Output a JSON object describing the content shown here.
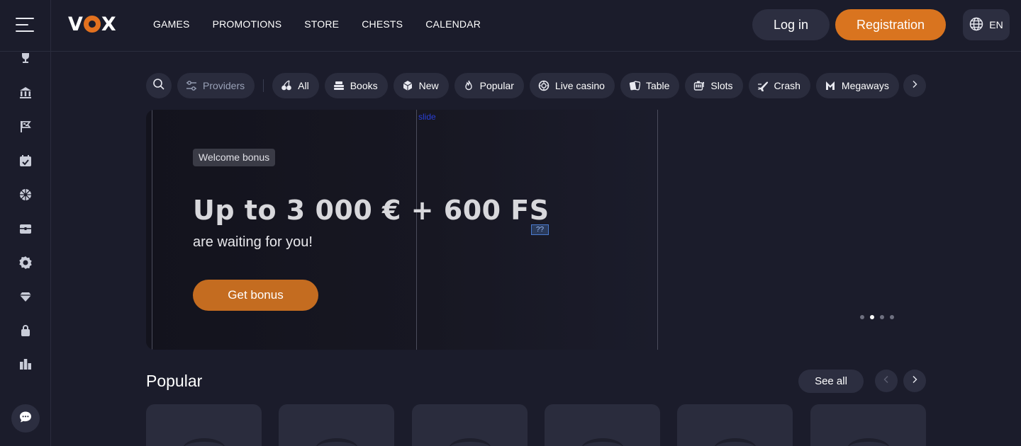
{
  "brand": {
    "logo_text": "VOX",
    "accent_color": "#d9741f"
  },
  "nav": {
    "items": [
      "GAMES",
      "PROMOTIONS",
      "STORE",
      "CHESTS",
      "CALENDAR"
    ]
  },
  "auth": {
    "login_label": "Log in",
    "register_label": "Registration"
  },
  "language": {
    "code": "EN",
    "icon": "globe-icon"
  },
  "sidebar": {
    "icons": [
      "trophy-icon",
      "bank-icon",
      "flags-icon",
      "calendar-icon",
      "wheel-icon",
      "chest-icon",
      "badge-icon",
      "diamond-icon",
      "lock-icon",
      "leaderboard-icon"
    ],
    "chat_icon": "chat-icon"
  },
  "filters": {
    "providers_label": "Providers",
    "categories": [
      {
        "label": "All",
        "icon": "cherries-icon"
      },
      {
        "label": "Books",
        "icon": "books-icon"
      },
      {
        "label": "New",
        "icon": "dice-icon"
      },
      {
        "label": "Popular",
        "icon": "fire-icon"
      },
      {
        "label": "Live casino",
        "icon": "chip-icon"
      },
      {
        "label": "Table",
        "icon": "cards-icon"
      },
      {
        "label": "Slots",
        "icon": "slot-icon"
      },
      {
        "label": "Crash",
        "icon": "plane-icon"
      },
      {
        "label": "Megaways",
        "icon": "megaways-icon"
      }
    ]
  },
  "banner": {
    "slide_label": "slide",
    "badge": "Welcome bonus",
    "title": "Up to 3 000 € + 600 FS",
    "subtitle": "are waiting for you!",
    "cta": "Get bonus",
    "broken_image_text": "??",
    "slides_count": 4,
    "active_slide": 1
  },
  "popular": {
    "title": "Popular",
    "see_all": "See all",
    "cards_count": 6
  }
}
